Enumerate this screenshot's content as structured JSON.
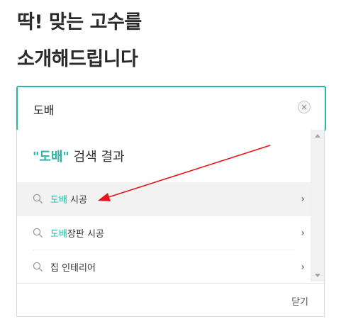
{
  "headline": {
    "line1": "딱! 맞는 고수를",
    "line2": "소개해드립니다"
  },
  "search": {
    "value": "도배"
  },
  "results": {
    "quote_open": "\"",
    "keyword": "도배",
    "quote_close": "\"",
    "suffix": " 검색 결과",
    "items": [
      {
        "highlight": "도배",
        "rest": " 시공",
        "chevron": "›"
      },
      {
        "highlight": "도배",
        "rest": "장판 시공",
        "chevron": "›"
      },
      {
        "highlight": "",
        "rest": "집 인테리어",
        "chevron": "›"
      }
    ]
  },
  "footer": {
    "close_label": "닫기"
  },
  "colors": {
    "accent": "#2ab5a5",
    "annotation": "#e8141a"
  }
}
